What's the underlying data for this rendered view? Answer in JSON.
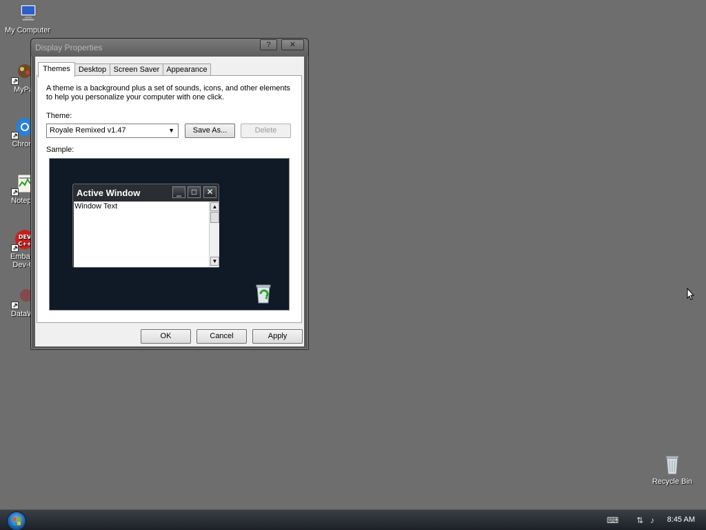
{
  "desktop": {
    "icons": [
      {
        "label": "My Computer"
      },
      {
        "label": "MyPa"
      },
      {
        "label": "Chrom"
      },
      {
        "label": "Notepa"
      },
      {
        "label": "Embarc\nDev-C"
      },
      {
        "label": "DataWi"
      }
    ],
    "recycle_bin": {
      "label": "Recycle Bin"
    }
  },
  "dialog": {
    "title": "Display Properties",
    "help_btn": "?",
    "close_btn": "✕",
    "tabs": [
      {
        "label": "Themes"
      },
      {
        "label": "Desktop"
      },
      {
        "label": "Screen Saver"
      },
      {
        "label": "Appearance"
      }
    ],
    "description": "A theme is a background plus a set of sounds, icons, and other elements to help you personalize your computer with one click.",
    "theme_label": "Theme:",
    "theme_value": "Royale Remixed v1.47",
    "save_as_label": "Save As...",
    "delete_label": "Delete",
    "sample_label": "Sample:",
    "sample": {
      "window_title": "Active Window",
      "window_text": "Window Text",
      "min_btn": "_",
      "max_btn": "□",
      "close_btn": "✕"
    },
    "ok_label": "OK",
    "cancel_label": "Cancel",
    "apply_label": "Apply"
  },
  "taskbar": {
    "clock": "8:45 AM"
  }
}
